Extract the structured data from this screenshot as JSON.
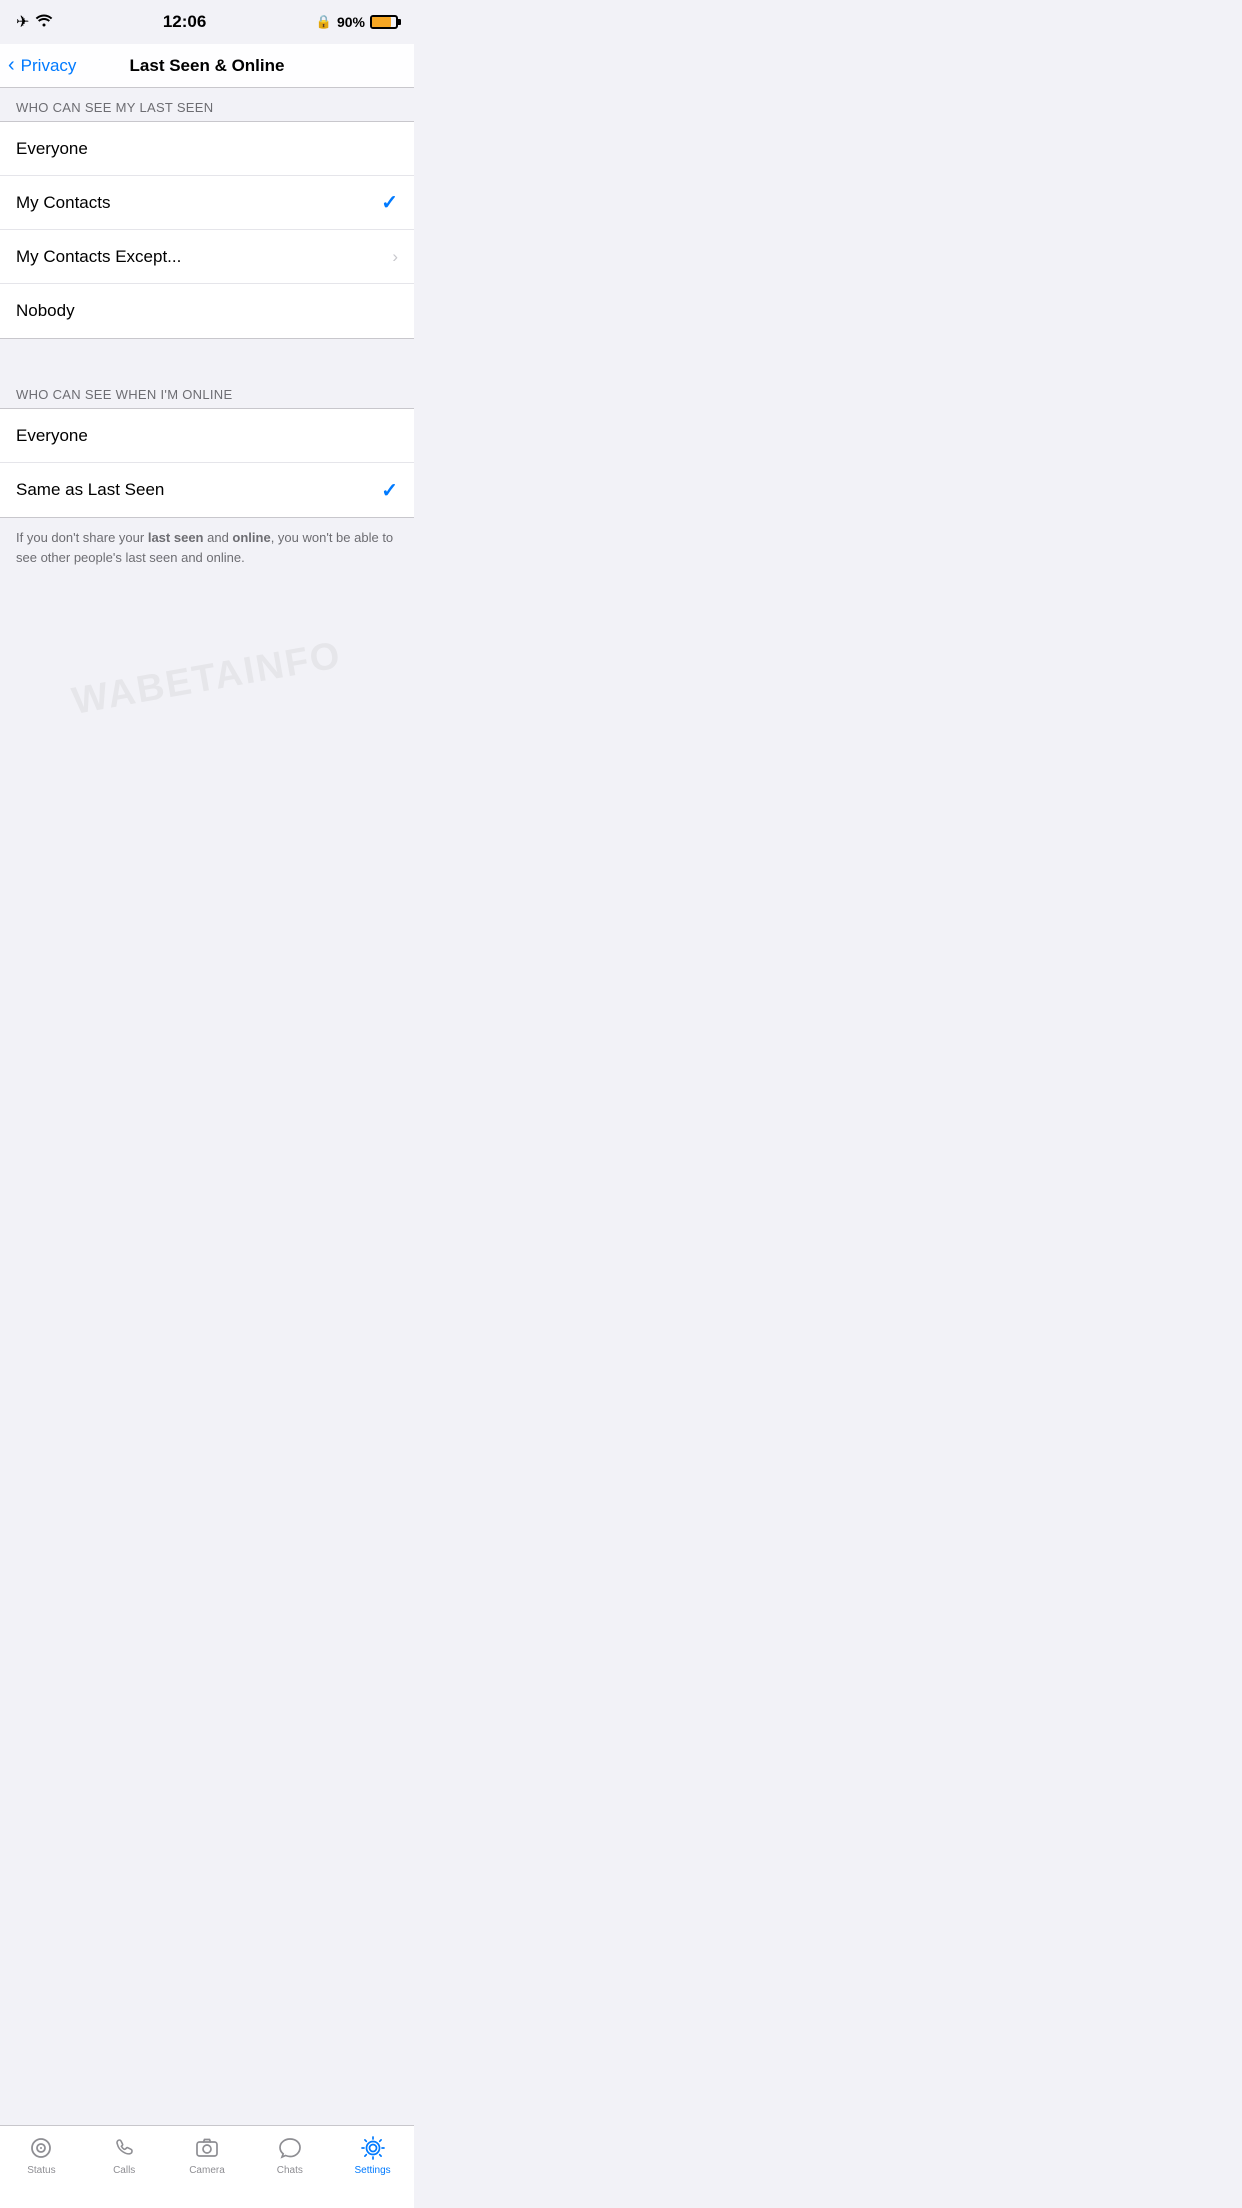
{
  "statusBar": {
    "time": "12:06",
    "battery": "90%"
  },
  "navBar": {
    "backLabel": "Privacy",
    "title": "Last Seen & Online"
  },
  "watermark": "WABETAINFO",
  "lastSeenSection": {
    "header": "WHO CAN SEE MY LAST SEEN",
    "options": [
      {
        "label": "Everyone",
        "checked": false,
        "hasChevron": false
      },
      {
        "label": "My Contacts",
        "checked": true,
        "hasChevron": false
      },
      {
        "label": "My Contacts Except...",
        "checked": false,
        "hasChevron": true
      },
      {
        "label": "Nobody",
        "checked": false,
        "hasChevron": false
      }
    ]
  },
  "onlineSection": {
    "header": "WHO CAN SEE WHEN I'M ONLINE",
    "options": [
      {
        "label": "Everyone",
        "checked": false,
        "hasChevron": false
      },
      {
        "label": "Same as Last Seen",
        "checked": true,
        "hasChevron": false
      }
    ]
  },
  "infoText": {
    "before": "If you don't share your ",
    "bold1": "last seen",
    "middle": " and ",
    "bold2": "online",
    "after": ", you won't be able to see other people's last seen and online."
  },
  "tabBar": {
    "items": [
      {
        "label": "Status",
        "icon": "status-icon",
        "active": false
      },
      {
        "label": "Calls",
        "icon": "calls-icon",
        "active": false
      },
      {
        "label": "Camera",
        "icon": "camera-icon",
        "active": false
      },
      {
        "label": "Chats",
        "icon": "chats-icon",
        "active": false
      },
      {
        "label": "Settings",
        "icon": "settings-icon",
        "active": true
      }
    ]
  }
}
